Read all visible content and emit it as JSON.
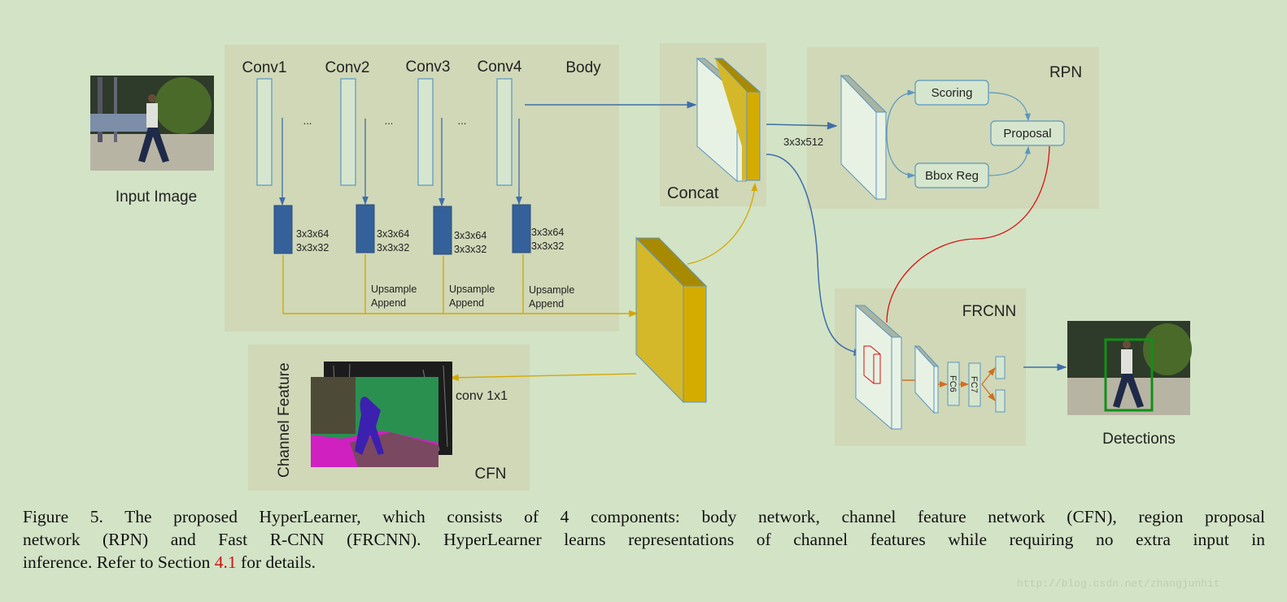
{
  "colors": {
    "background": "#d3e3c6",
    "panel": "#d0d8b7",
    "conv_outline": "#5a96c0",
    "block_fill": "#35619a",
    "feature_yellow": "#d4b82a",
    "arrow_blue": "#3d6ea8",
    "arrow_yellow": "#d4a800",
    "arrow_red": "#d81010",
    "arrow_orange": "#d07020",
    "detection_box": "#129018"
  },
  "input": {
    "label": "Input Image"
  },
  "body": {
    "title": "Body",
    "convs": [
      "Conv1",
      "Conv2",
      "Conv3",
      "Conv4"
    ],
    "ellipsis": "...",
    "kernel_top": "3x3x64",
    "kernel_bottom": "3x3x32",
    "upsample": "Upsample",
    "append": "Append"
  },
  "concat": {
    "label": "Concat"
  },
  "rpn": {
    "title": "RPN",
    "input_dim": "3x3x512",
    "scoring": "Scoring",
    "bbox_reg": "Bbox Reg",
    "proposal": "Proposal"
  },
  "frcnn": {
    "title": "FRCNN",
    "fc6": "FC6",
    "fc7": "FC7"
  },
  "cfn": {
    "title": "CFN",
    "side_label": "Channel Feature",
    "conv": "conv 1x1"
  },
  "output": {
    "label": "Detections"
  },
  "caption": {
    "line1": "Figure 5. The proposed HyperLearner, which consists of 4 components: body network, channel feature network (CFN), region proposal",
    "line2": "network (RPN) and Fast R-CNN (FRCNN). HyperLearner learns representations of channel features while requiring no extra input in",
    "line3_a": "inference. Refer to Section ",
    "line3_ref": "4.1",
    "line3_b": " for details."
  },
  "watermark": "http://blog.csdn.net/zhangjunhit"
}
